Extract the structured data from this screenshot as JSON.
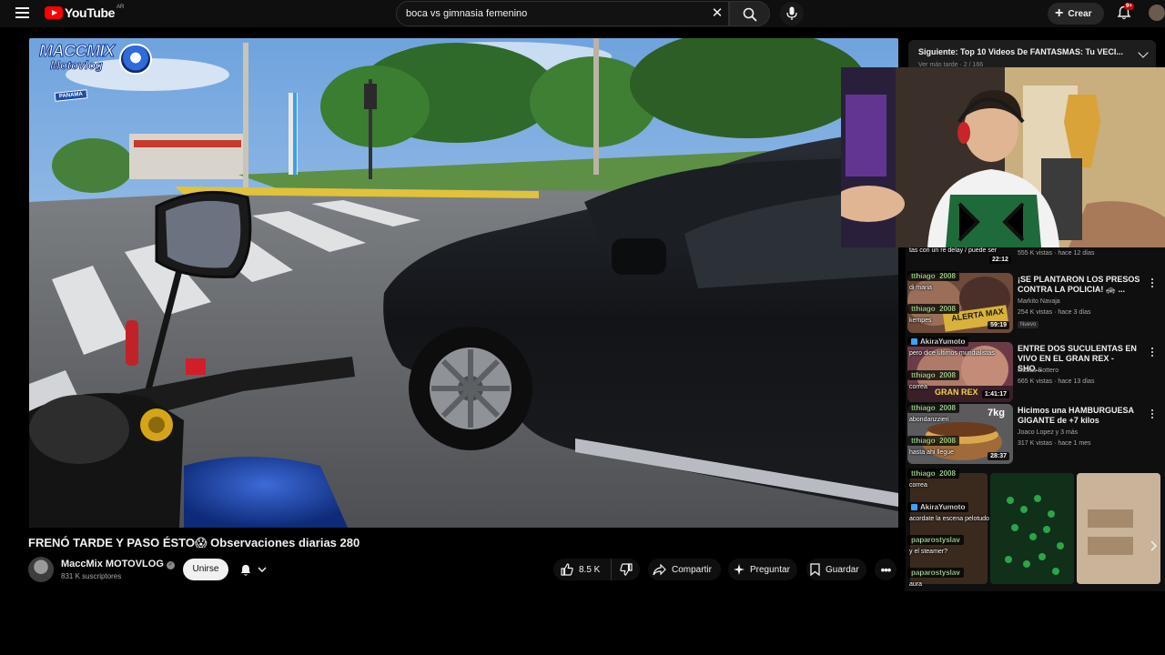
{
  "header": {
    "logo_text": "YouTube",
    "country_code": "AR",
    "search_value": "boca vs gimnasia femenino",
    "create_label": "Crear",
    "notifications_count": "9+"
  },
  "video": {
    "street_sign": "PANAMA",
    "watermark_title": "MACCMIX",
    "watermark_subtitle": "Motovlog",
    "title": "FRENÓ TARDE Y PASO ÉSTO😱 Observaciones diarias 280"
  },
  "channel": {
    "name": "MaccMix MOTOVLOG",
    "subscribers": "831 K suscriptores",
    "join_label": "Unirse"
  },
  "actions": {
    "likes": "8.5 K",
    "share_label": "Compartir",
    "ask_label": "Preguntar",
    "save_label": "Guardar"
  },
  "up_next": {
    "label": "Siguiente: Top 10 Videos De FANTASMAS: Tu VECI...",
    "sub": "Ver más tarde · 2 / 166"
  },
  "recommendations": [
    {
      "title": "¡SE PLANTARON LOS PRESOS CONTRA LA POLICIA! 🚓 ...",
      "channel": "Markito Navaja",
      "meta": "254 K vistas · hace 3 días",
      "badge": "Nuevo",
      "duration": "59:19"
    },
    {
      "title": "ENTRE DOS SUCULENTAS EN VIVO EN EL GRAN REX - SHO...",
      "channel": "Matias Bottero",
      "meta": "665 K vistas · hace 13 días",
      "duration": "1:41:17"
    },
    {
      "title": "Hicimos una HAMBURGUESA GIGANTE de +7 kilos",
      "channel": "Joaco Lopez y 3 más",
      "meta": "317 K vistas · hace 1 mes",
      "duration": "28:37"
    }
  ],
  "top_rec_meta": "555 K vistas · hace 12 días",
  "top_rec_duration": "22:12",
  "thumb_overlays": {
    "rec1": "ALERTA MAX",
    "rec2": "GRAN REX",
    "rec3": "7kg"
  },
  "chat": [
    {
      "user": "",
      "msg": "tas con un re delay / puede ser"
    },
    {
      "user": "tthiago_2008",
      "msg": "di maria"
    },
    {
      "user": "tthiago_2008",
      "msg": "kempes"
    },
    {
      "user": "AkiraYumoto",
      "msg": "pero dice ultimos mundialistas",
      "mod": true
    },
    {
      "user": "tthiago_2008",
      "msg": "correa"
    },
    {
      "user": "tthiago_2008",
      "msg": "abondanzzieri"
    },
    {
      "user": "tthiago_2008",
      "msg": "hasta ahi llegue"
    },
    {
      "user": "tthiago_2008",
      "msg": "correa"
    },
    {
      "user": "AkiraYumoto",
      "msg": "acordate la escena pelotudo",
      "mod": true
    },
    {
      "user": "paparostyslav",
      "msg": "y el steamer?"
    },
    {
      "user": "paparostyslav",
      "msg": "aura"
    }
  ],
  "colors": {
    "background": "#0f0f0f",
    "brand_red": "#ff0000",
    "chip": "#272727",
    "text": "#f1f1f1",
    "muted": "#aaaaaa"
  }
}
